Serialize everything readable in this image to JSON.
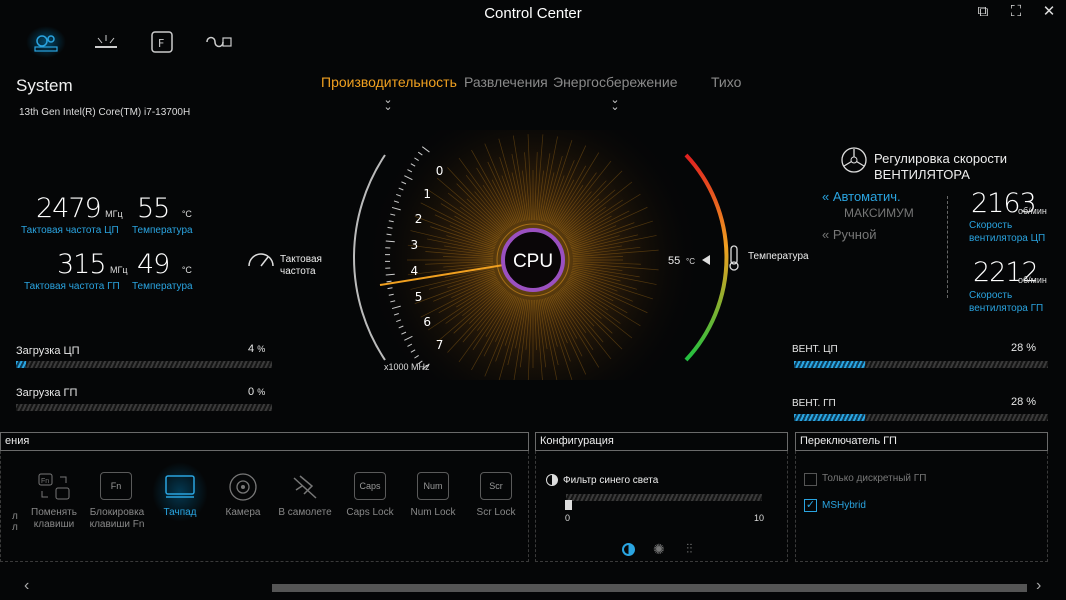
{
  "window": {
    "title": "Control Center"
  },
  "system": {
    "title": "System",
    "cpu": "13th Gen Intel(R) Core(TM) i7-13700H"
  },
  "modes": [
    "Производительность",
    "Развлечения",
    "Энергосбережение",
    "Тихо"
  ],
  "stats": {
    "cpu_clock": {
      "value": "2479",
      "unit": "МГц",
      "label": "Тактовая частота ЦП"
    },
    "cpu_temp": {
      "value": "55",
      "unit": "°C",
      "label": "Температура"
    },
    "gpu_clock": {
      "value": "315",
      "unit": "МГц",
      "label": "Тактовая частота ГП"
    },
    "gpu_temp": {
      "value": "49",
      "unit": "°C",
      "label": "Температура"
    }
  },
  "load": {
    "cpu": {
      "label": "Загрузка ЦП",
      "value": "4",
      "unit": "%",
      "fraction": 0.04
    },
    "gpu": {
      "label": "Загрузка ГП",
      "value": "0",
      "unit": "%",
      "fraction": 0.0
    }
  },
  "gauge": {
    "center": "CPU",
    "ticks": [
      "7",
      "6",
      "5",
      "4",
      "3",
      "2",
      "1",
      "0"
    ],
    "unit": "x1000 MHz",
    "clock_label": "Тактовая частота",
    "temp_value": "55",
    "temp_unit": "°C",
    "temp_label": "Температура"
  },
  "fan": {
    "title_line1": "Регулировка скорости",
    "title_line2": "ВЕНТИЛЯТОРА",
    "modes": [
      "Автоматич.",
      "МАКСИМУМ",
      "Ручной"
    ],
    "cpu_speed": "2163",
    "cpu_speed_unit": "об/мин",
    "cpu_speed_label1": "Скорость",
    "cpu_speed_label2": "вентилятора ЦП",
    "gpu_speed": "2212",
    "gpu_speed_unit": "об/мин",
    "gpu_speed_label1": "Скорость",
    "gpu_speed_label2": "вентилятора ГП",
    "cpu_fan": {
      "label": "ВЕНТ. ЦП",
      "value": "28 %",
      "fraction": 0.28
    },
    "gpu_fan": {
      "label": "ВЕНТ. ГП",
      "value": "28 %",
      "fraction": 0.28
    }
  },
  "panels": {
    "left_title": "ения",
    "keys": [
      {
        "label": "Поменять\nклавиши",
        "key": "Fn"
      },
      {
        "label": "Блокировка\nклавиши Fn",
        "key": "Fn"
      },
      {
        "label": "Тачпад",
        "key": ""
      },
      {
        "label": "Камера",
        "key": ""
      },
      {
        "label": "В самолете",
        "key": ""
      },
      {
        "label": "Caps Lock",
        "key": "Caps"
      },
      {
        "label": "Num Lock",
        "key": "Num"
      },
      {
        "label": "Scr Lock",
        "key": "Scr"
      }
    ],
    "config_title": "Конфигурация",
    "bluelight_label": "Фильтр синего света",
    "slider_min": "0",
    "slider_max": "10",
    "gpu_switch_title": "Переключатель ГП",
    "gpu_options": [
      "Только дискретный ГП",
      "MSHybrid"
    ]
  },
  "colors": {
    "accent": "#2aa4e0",
    "active_mode": "#f0a020",
    "cpu_ring": "#9a50c0"
  }
}
